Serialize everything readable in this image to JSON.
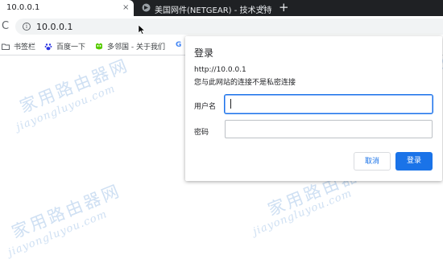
{
  "browser": {
    "active_tab": {
      "title": "10.0.0.1",
      "close_glyph": "×"
    },
    "inactive_tab": {
      "title": "美国网件(NETGEAR) - 技术支持",
      "close_glyph": "×",
      "favicon": "netgear-favicon"
    },
    "new_tab_glyph": "+",
    "reload_glyph": "C",
    "info_glyph": "i",
    "url": "10.0.0.1"
  },
  "bookmarks": [
    {
      "label": "书签栏",
      "icon": "folder-icon"
    },
    {
      "label": "百度一下",
      "icon": "baidu-paw-icon"
    },
    {
      "label": "多邻国 - 关于我们",
      "icon": "duolingo-owl-icon"
    },
    {
      "label": "G",
      "icon": "google-icon"
    }
  ],
  "dialog": {
    "title": "登录",
    "url": "http://10.0.0.1",
    "warning": "您与此网站的连接不是私密连接",
    "username_label": "用户名",
    "password_label": "密码",
    "username_value": "",
    "password_value": "",
    "cancel_label": "取消",
    "login_label": "登录"
  },
  "watermark": {
    "cn": "家用路由器网",
    "en": "jiayongluyou.com"
  },
  "colors": {
    "accent": "#1a73e8",
    "tabstrip": "#1f2124",
    "watermark": "#cfe0f3"
  }
}
